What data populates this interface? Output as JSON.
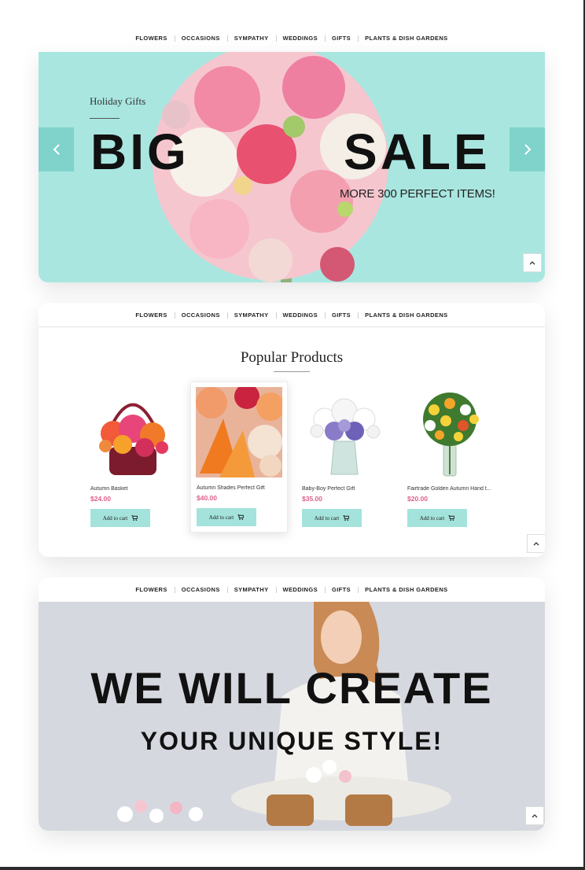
{
  "nav_top": {
    "items": [
      "FLOWERS",
      "OCCASIONS",
      "SYMPATHY",
      "WEDDINGS",
      "GIFTS",
      "PLANTS & DISH GARDENS"
    ]
  },
  "hero_sale": {
    "kicker": "Holiday Gifts",
    "word_left": "BIG",
    "word_right": "SALE",
    "subtitle": "MORE 300 PERFECT ITEMS!",
    "prev_icon": "chevron-left-icon",
    "next_icon": "chevron-right-icon",
    "scroll_icon": "chevron-up-icon",
    "background": "#a9e6e0"
  },
  "nav_products": {
    "items": [
      "FLOWERS",
      "OCCASIONS",
      "SYMPATHY",
      "WEDDINGS",
      "GIFTS",
      "PLANTS & DISH GARDENS"
    ]
  },
  "popular": {
    "title": "Popular Products",
    "products": [
      {
        "name": "Autumn Basket",
        "price": "$24.00",
        "cta": "Add to cart"
      },
      {
        "name": "Autumn Shades Perfect Gift",
        "price": "$40.00",
        "cta": "Add to cart"
      },
      {
        "name": "Baby-Boy Perfect Gift",
        "price": "$35.00",
        "cta": "Add to cart"
      },
      {
        "name": "Fairtrade Golden Autumn Hand t...",
        "price": "$20.00",
        "cta": "Add to cart"
      }
    ],
    "price_color": "#e0608a",
    "button_color": "#a3e3dc"
  },
  "nav_style": {
    "items": [
      "FLOWERS",
      "OCCASIONS",
      "SYMPATHY",
      "WEDDINGS",
      "GIFTS",
      "PLANTS & DISH GARDENS"
    ]
  },
  "hero_style": {
    "line1": "WE WILL CREATE",
    "line2": "YOUR UNIQUE STYLE!"
  }
}
